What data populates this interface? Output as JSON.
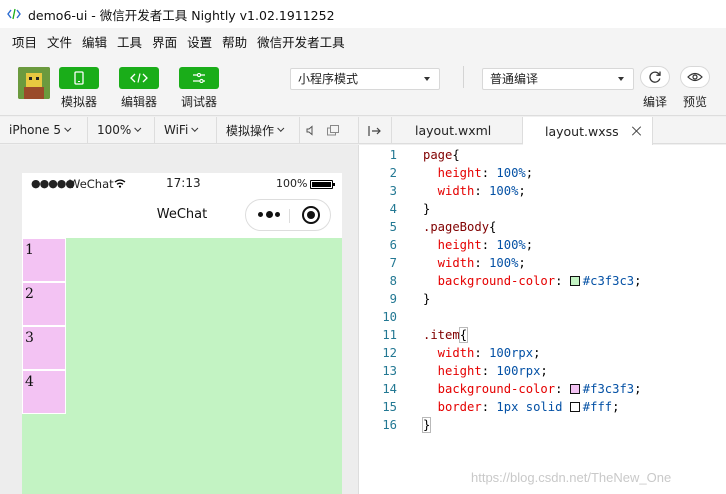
{
  "window": {
    "title": "demo6-ui - 微信开发者工具 Nightly v1.02.1911252"
  },
  "menubar": {
    "items": [
      "项目",
      "文件",
      "编辑",
      "工具",
      "界面",
      "设置",
      "帮助",
      "微信开发者工具"
    ]
  },
  "toolbar": {
    "simulator_label": "模拟器",
    "editor_label": "编辑器",
    "debugger_label": "调试器",
    "mode_select": "小程序模式",
    "compile_select": "普通编译",
    "compile_label": "编译",
    "preview_label": "预览",
    "accent_color": "#1aad19"
  },
  "simbar": {
    "device": "iPhone 5",
    "zoom": "100%",
    "network": "WiFi",
    "sim_ops": "模拟操作"
  },
  "phone": {
    "signal": "●●●●●",
    "carrier": "WeChat",
    "time": "17:13",
    "battery_pct": "100%",
    "nav_title": "WeChat",
    "items": [
      "1",
      "2",
      "3",
      "4"
    ],
    "page_bg": "#c3f3c3",
    "item_bg": "#f3c3f3"
  },
  "editor_tabs": {
    "tab1": "layout.wxml",
    "tab2": "layout.wxss"
  },
  "code": {
    "lines": [
      {
        "n": "1",
        "segs": [
          [
            "sel",
            "page"
          ],
          [
            "punc",
            "{"
          ]
        ]
      },
      {
        "n": "2",
        "segs": [
          [
            "prop",
            "  height"
          ],
          [
            "punc",
            ": "
          ],
          [
            "val",
            "100%"
          ],
          [
            "punc",
            ";"
          ]
        ]
      },
      {
        "n": "3",
        "segs": [
          [
            "prop",
            "  width"
          ],
          [
            "punc",
            ": "
          ],
          [
            "val",
            "100%"
          ],
          [
            "punc",
            ";"
          ]
        ]
      },
      {
        "n": "4",
        "segs": [
          [
            "punc",
            "}"
          ]
        ]
      },
      {
        "n": "5",
        "segs": [
          [
            "sel",
            ".pageBody"
          ],
          [
            "punc",
            "{"
          ]
        ]
      },
      {
        "n": "6",
        "segs": [
          [
            "prop",
            "  height"
          ],
          [
            "punc",
            ": "
          ],
          [
            "val",
            "100%"
          ],
          [
            "punc",
            ";"
          ]
        ]
      },
      {
        "n": "7",
        "segs": [
          [
            "prop",
            "  width"
          ],
          [
            "punc",
            ": "
          ],
          [
            "val",
            "100%"
          ],
          [
            "punc",
            ";"
          ]
        ]
      },
      {
        "n": "8",
        "segs": [
          [
            "prop",
            "  background-color"
          ],
          [
            "punc",
            ": "
          ],
          [
            "swatch",
            "#c3f3c3"
          ],
          [
            "val",
            "#c3f3c3"
          ],
          [
            "punc",
            ";"
          ]
        ]
      },
      {
        "n": "9",
        "segs": [
          [
            "punc",
            "}"
          ]
        ]
      },
      {
        "n": "10",
        "segs": []
      },
      {
        "n": "11",
        "segs": [
          [
            "sel",
            ".item"
          ],
          [
            "bracket",
            "{"
          ]
        ]
      },
      {
        "n": "12",
        "segs": [
          [
            "prop",
            "  width"
          ],
          [
            "punc",
            ": "
          ],
          [
            "val",
            "100rpx"
          ],
          [
            "punc",
            ";"
          ]
        ]
      },
      {
        "n": "13",
        "segs": [
          [
            "prop",
            "  height"
          ],
          [
            "punc",
            ": "
          ],
          [
            "val",
            "100rpx"
          ],
          [
            "punc",
            ";"
          ]
        ]
      },
      {
        "n": "14",
        "segs": [
          [
            "prop",
            "  background-color"
          ],
          [
            "punc",
            ": "
          ],
          [
            "swatch",
            "#f3c3f3"
          ],
          [
            "val",
            "#f3c3f3"
          ],
          [
            "punc",
            ";"
          ]
        ]
      },
      {
        "n": "15",
        "segs": [
          [
            "prop",
            "  border"
          ],
          [
            "punc",
            ": "
          ],
          [
            "val",
            "1px solid "
          ],
          [
            "swatch",
            "#fff"
          ],
          [
            "val",
            "#fff"
          ],
          [
            "punc",
            ";"
          ]
        ]
      },
      {
        "n": "16",
        "segs": [
          [
            "bracket",
            "}"
          ]
        ]
      }
    ]
  },
  "watermark": "https://blog.csdn.net/TheNew_One"
}
